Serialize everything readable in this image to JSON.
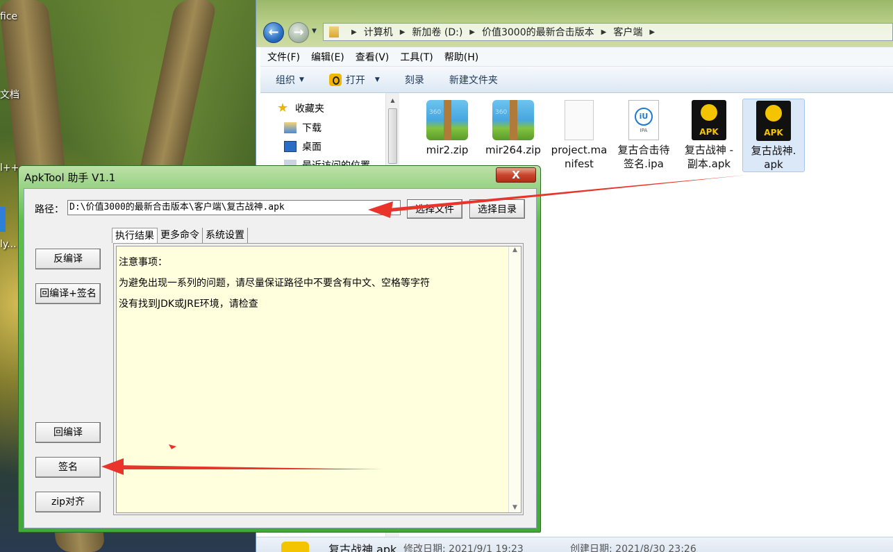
{
  "desktop": {
    "labels": [
      "fice",
      "文档",
      "l++",
      "ly..."
    ]
  },
  "explorer": {
    "breadcrumb": [
      "计算机",
      "新加卷 (D:)",
      "价值3000的最新合击版本",
      "客户端"
    ],
    "menu": [
      "文件(F)",
      "编辑(E)",
      "查看(V)",
      "工具(T)",
      "帮助(H)"
    ],
    "toolbar": {
      "organize": "组织",
      "open": "打开",
      "burn": "刻录",
      "new_folder": "新建文件夹"
    },
    "nav": [
      "收藏夹",
      "下载",
      "桌面",
      "最近访问的位置"
    ],
    "files": [
      {
        "name": "mir2.zip",
        "type": "zip"
      },
      {
        "name": "mir264.zip",
        "type": "zip"
      },
      {
        "name": "project.manifest",
        "line1": "project.ma",
        "line2": "nifest",
        "type": "doc"
      },
      {
        "name": "复古合击待签名.ipa",
        "line1": "复古合击待",
        "line2": "签名.ipa",
        "type": "ipa",
        "icon_label": "IPA"
      },
      {
        "name": "复古战神 - 副本.apk",
        "line1": "复古战神 -",
        "line2": "副本.apk",
        "type": "apk",
        "icon_label": "APK"
      },
      {
        "name": "复古战神.apk",
        "line1": "复古战神.",
        "line2": "apk",
        "type": "apk",
        "icon_label": "APK",
        "selected": true
      }
    ],
    "details": {
      "name": "复古战神.apk",
      "modified": "修改日期: 2021/9/1 19:23",
      "created": "创建日期: 2021/8/30 23:26"
    }
  },
  "apktool": {
    "title": "ApkTool 助手 V1.1",
    "close": "X",
    "path_label": "路径：",
    "path_value": "D:\\价值3000的最新合击版本\\客户端\\复古战神.apk",
    "select_file": "选择文件",
    "select_dir": "选择目录",
    "tabs": [
      "执行结果",
      "更多命令",
      "系统设置"
    ],
    "buttons": {
      "decompile": "反编译",
      "recompile_sign": "回编译+签名",
      "recompile": "回编译",
      "sign": "签名",
      "zipalign": "zip对齐"
    },
    "output": [
      "注意事项：",
      "为避免出现一系列的问题，请尽量保证路径中不要含有中文、空格等字符",
      "没有找到JDK或JRE环境，请检查"
    ]
  },
  "colors": {
    "annotation_arrow": "#e8342a",
    "output_bg": "#ffffdd",
    "window_frame": "#42a93a"
  }
}
